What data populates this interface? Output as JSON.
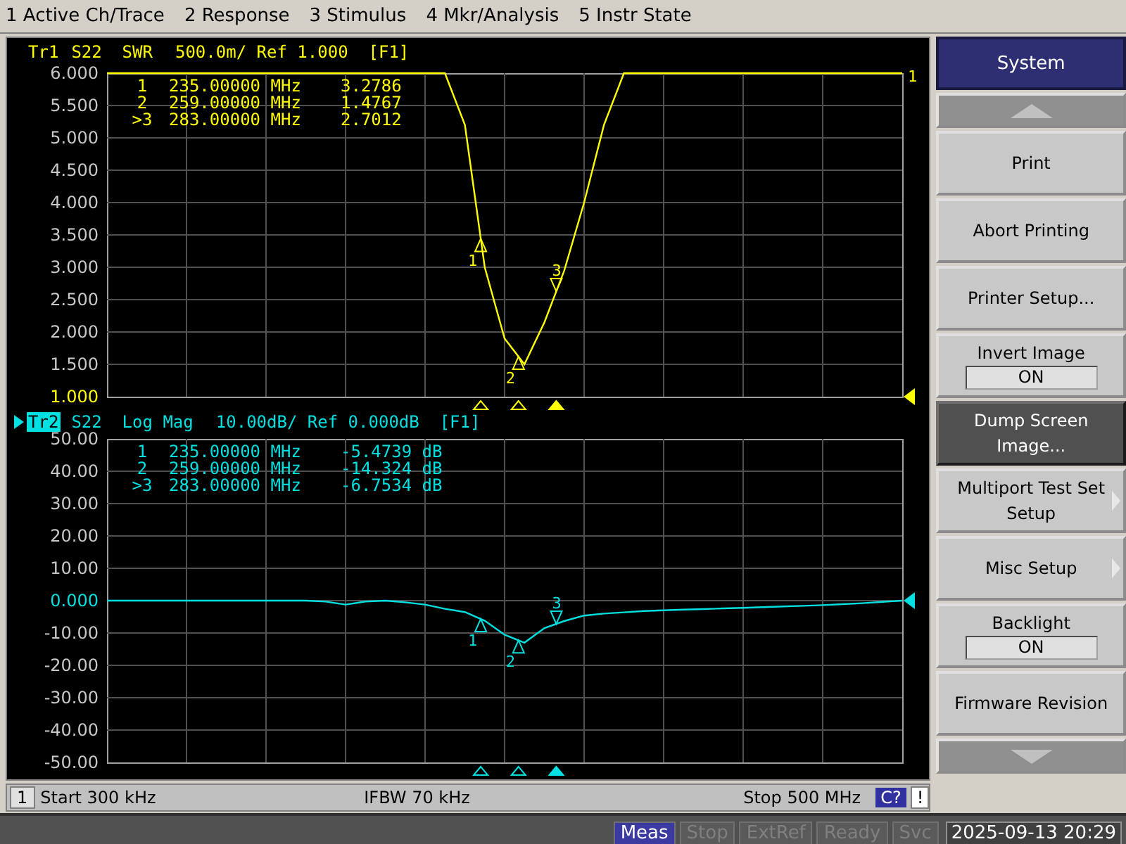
{
  "menu_bar": [
    {
      "label": "1 Active Ch/Trace"
    },
    {
      "label": "2 Response"
    },
    {
      "label": "3 Stimulus"
    },
    {
      "label": "4 Mkr/Analysis"
    },
    {
      "label": "5 Instr State"
    }
  ],
  "traces": [
    {
      "tag": "Tr1",
      "scale": "500.0m/ Ref 1.000  [F1]",
      "selected": false,
      "reference_at_bottom": true,
      "edge_label": "1",
      "chart_data": {
        "type": "line",
        "categories": [
          null,
          null,
          null,
          null,
          null,
          null,
          null,
          null,
          null,
          null,
          null,
          null,
          null,
          null,
          null,
          null,
          null,
          null,
          null,
          null,
          null,
          null,
          null,
          null,
          null,
          null,
          null,
          null,
          null,
          null,
          null,
          null,
          null,
          null,
          null,
          null,
          null,
          null,
          null,
          null,
          null
        ],
        "ylim": [
          1,
          6
        ],
        "grid": true,
        "yticks": [
          {
            "value": 6,
            "label": "6.000"
          },
          {
            "value": 5.5,
            "label": "5.500"
          },
          {
            "value": 5,
            "label": "5.000"
          },
          {
            "value": 4.5,
            "label": "4.500"
          },
          {
            "value": 4,
            "label": "4.000"
          },
          {
            "value": 3.5,
            "label": "3.500"
          },
          {
            "value": 3,
            "label": "3.000"
          },
          {
            "value": 2.5,
            "label": "2.500"
          },
          {
            "value": 2,
            "label": "2.000"
          },
          {
            "value": 1.5,
            "label": "1.500"
          },
          {
            "value": 1,
            "label": "1.000"
          }
        ],
        "series": [
          {
            "name": "S22  SWR",
            "color": "#ffff00",
            "values": [
              6,
              6,
              6,
              6,
              6,
              6,
              6,
              6,
              6,
              6,
              6,
              6,
              6,
              6,
              6,
              6,
              6,
              6,
              5.2,
              3.0,
              1.9,
              1.5,
              2.15,
              2.95,
              4.0,
              5.2,
              6,
              6,
              6,
              6,
              6,
              6,
              6,
              6,
              6,
              6,
              6,
              6,
              6,
              6,
              6
            ]
          }
        ]
      },
      "markers": [
        {
          "table_label": "1",
          "frequency": "235.00000 MHz",
          "value": "3.2786",
          "plot_label": "1",
          "active": false
        },
        {
          "table_label": "2",
          "frequency": "259.00000 MHz",
          "value": "1.4767",
          "plot_label": "2",
          "active": false
        },
        {
          "table_label": ">3",
          "frequency": "283.00000 MHz",
          "value": "2.7012",
          "plot_label": "3",
          "active": true
        }
      ]
    },
    {
      "tag": "Tr2",
      "scale": "10.00dB/ Ref 0.000dB  [F1]",
      "selected": true,
      "reference_at_bottom": false,
      "chart_data": {
        "type": "line",
        "categories": [
          null,
          null,
          null,
          null,
          null,
          null,
          null,
          null,
          null,
          null,
          null,
          null,
          null,
          null,
          null,
          null,
          null,
          null,
          null,
          null,
          null,
          null,
          null,
          null,
          null,
          null,
          null,
          null,
          null,
          null,
          null,
          null,
          null,
          null,
          null,
          null,
          null,
          null,
          null,
          null,
          null
        ],
        "ylim": [
          -50,
          50
        ],
        "grid": true,
        "yticks": [
          {
            "value": 50,
            "label": "50.00"
          },
          {
            "value": 40,
            "label": "40.00"
          },
          {
            "value": 30,
            "label": "30.00"
          },
          {
            "value": 20,
            "label": "20.00"
          },
          {
            "value": 10,
            "label": "10.00"
          },
          {
            "value": 0,
            "label": "0.000"
          },
          {
            "value": -10,
            "label": "-10.00"
          },
          {
            "value": -20,
            "label": "-20.00"
          },
          {
            "value": -30,
            "label": "-30.00"
          },
          {
            "value": -40,
            "label": "-40.00"
          },
          {
            "value": -50,
            "label": "-50.00"
          }
        ],
        "series": [
          {
            "name": "S22  Log Mag",
            "color": "#00e0e0",
            "values": [
              0,
              0,
              0,
              0,
              0,
              0,
              0,
              0,
              0,
              0,
              0,
              -0.3,
              -1.2,
              -0.3,
              0,
              -0.5,
              -1.2,
              -2.5,
              -3.5,
              -6.2,
              -10.5,
              -13,
              -8.5,
              -6.3,
              -4.6,
              -4,
              -3.6,
              -3.2,
              -3,
              -2.8,
              -2.6,
              -2.4,
              -2.2,
              -2,
              -1.8,
              -1.6,
              -1.4,
              -1.1,
              -0.8,
              -0.4,
              0
            ]
          }
        ]
      },
      "markers": [
        {
          "table_label": "1",
          "frequency": "235.00000 MHz",
          "value": "-5.4739 dB",
          "plot_label": "1",
          "active": false
        },
        {
          "table_label": "2",
          "frequency": "259.00000 MHz",
          "value": "-14.324 dB",
          "plot_label": "2",
          "active": false
        },
        {
          "table_label": ">3",
          "frequency": "283.00000 MHz",
          "value": "-6.7534 dB",
          "plot_label": "3",
          "active": true
        }
      ]
    }
  ],
  "status_bar": {
    "channel": "1",
    "start": "Start 300 kHz",
    "ifbw": "IFBW 70 kHz",
    "stop": "Stop 500 MHz",
    "correction": "C?",
    "warning": "!"
  },
  "softkeys": [
    {
      "kind": "title",
      "label": "System"
    },
    {
      "kind": "scroll-up"
    },
    {
      "kind": "button",
      "label": "Print",
      "selected": false,
      "submenu": false
    },
    {
      "kind": "button",
      "label": "Abort Printing",
      "selected": false,
      "submenu": false
    },
    {
      "kind": "button",
      "label": "Printer Setup...",
      "selected": false,
      "submenu": false
    },
    {
      "kind": "toggle",
      "label": "Invert Image",
      "value": "ON"
    },
    {
      "kind": "button",
      "label": "Dump Screen Image...",
      "selected": true,
      "submenu": false
    },
    {
      "kind": "button",
      "label": "Multiport Test Set Setup",
      "selected": false,
      "submenu": true
    },
    {
      "kind": "button",
      "label": "Misc Setup",
      "selected": false,
      "submenu": true
    },
    {
      "kind": "toggle",
      "label": "Backlight",
      "value": "ON"
    },
    {
      "kind": "button",
      "label": "Firmware Revision",
      "selected": false,
      "submenu": false
    },
    {
      "kind": "scroll-down"
    }
  ],
  "indicators": [
    {
      "label": "Meas",
      "on": true
    },
    {
      "label": "Stop",
      "on": false
    },
    {
      "label": "ExtRef",
      "on": false
    },
    {
      "label": "Ready",
      "on": false
    },
    {
      "label": "Svc",
      "on": false
    }
  ],
  "datetime": "2025-09-13 20:29"
}
